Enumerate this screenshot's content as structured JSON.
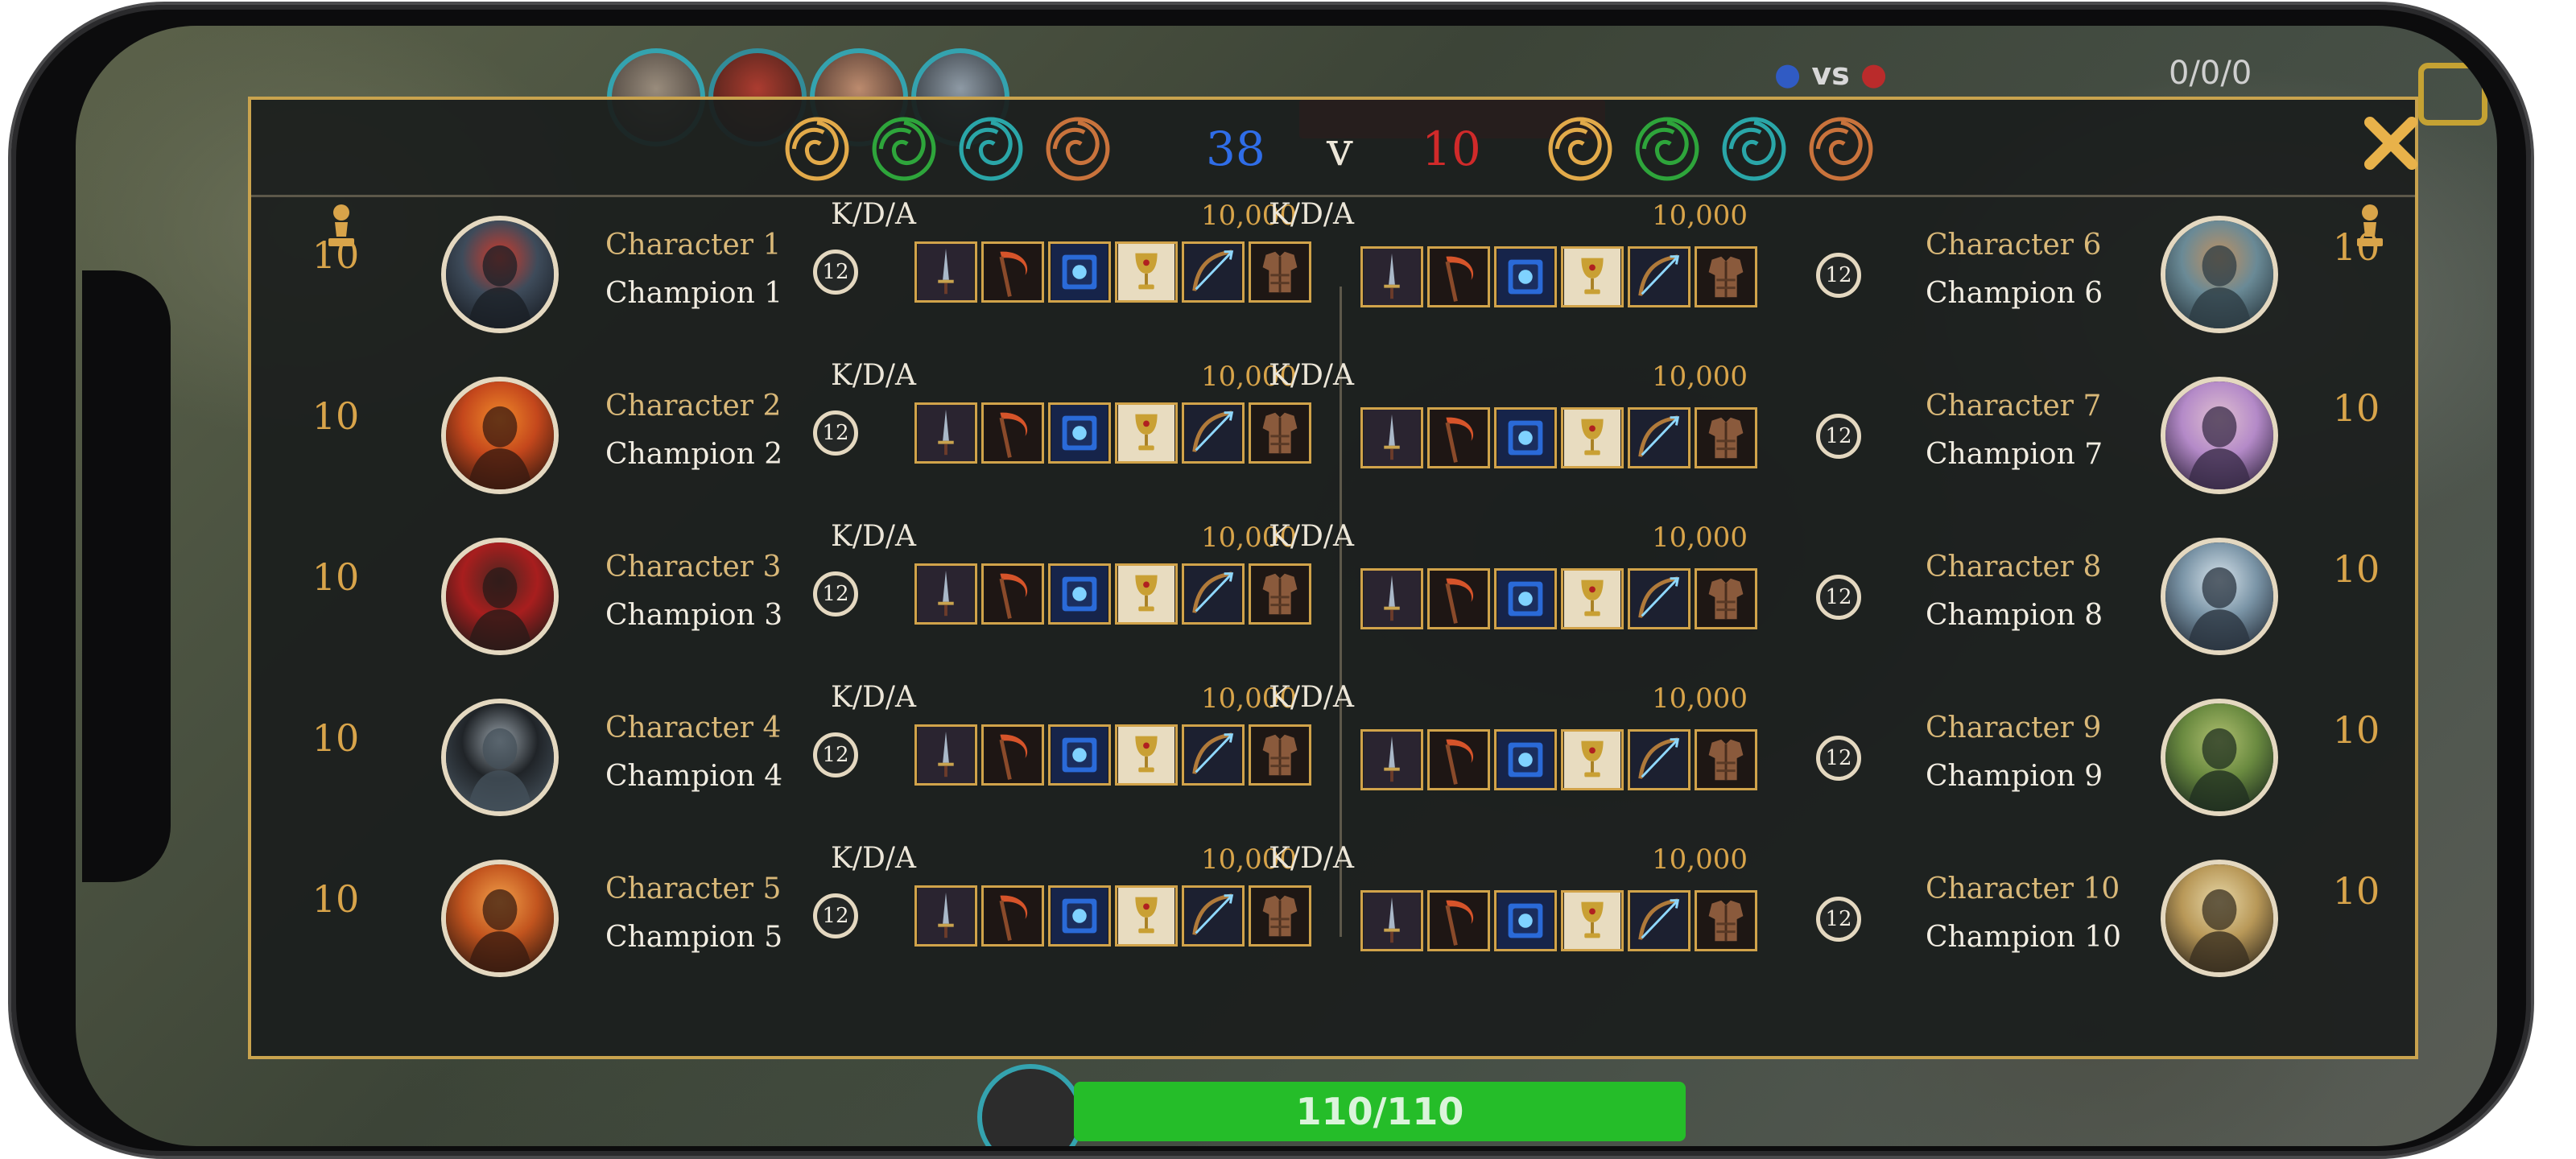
{
  "hud": {
    "vs_label": "vs",
    "kda_readout": "0/0/0",
    "hp_label": "110/110"
  },
  "scoreboard": {
    "blue_score": "38",
    "versus": "v",
    "red_score": "10",
    "colors": {
      "blue": "#2f6de8",
      "red": "#d02a2a",
      "gold": "#d8a44a",
      "accent": "#c9a34e"
    },
    "objective_icons": [
      "gold-swirl-icon",
      "green-swirl-icon",
      "teal-swirl-icon",
      "orange-swirl-icon"
    ]
  },
  "left_team": [
    {
      "level": "10",
      "character": "Character 1",
      "champion": "Champion 1",
      "rank": "12",
      "kda_label": "K/D/A",
      "gold": "10,000"
    },
    {
      "level": "10",
      "character": "Character 2",
      "champion": "Champion 2",
      "rank": "12",
      "kda_label": "K/D/A",
      "gold": "10,000"
    },
    {
      "level": "10",
      "character": "Character 3",
      "champion": "Champion 3",
      "rank": "12",
      "kda_label": "K/D/A",
      "gold": "10,000"
    },
    {
      "level": "10",
      "character": "Character 4",
      "champion": "Champion 4",
      "rank": "12",
      "kda_label": "K/D/A",
      "gold": "10,000"
    },
    {
      "level": "10",
      "character": "Character 5",
      "champion": "Champion 5",
      "rank": "12",
      "kda_label": "K/D/A",
      "gold": "10,000"
    }
  ],
  "right_team": [
    {
      "level": "10",
      "character": "Character 6",
      "champion": "Champion 6",
      "rank": "12",
      "kda_label": "K/D/A",
      "gold": "10,000"
    },
    {
      "level": "10",
      "character": "Character 7",
      "champion": "Champion 7",
      "rank": "12",
      "kda_label": "K/D/A",
      "gold": "10,000"
    },
    {
      "level": "10",
      "character": "Character 8",
      "champion": "Champion 8",
      "rank": "12",
      "kda_label": "K/D/A",
      "gold": "10,000"
    },
    {
      "level": "10",
      "character": "Character 9",
      "champion": "Champion 9",
      "rank": "12",
      "kda_label": "K/D/A",
      "gold": "10,000"
    },
    {
      "level": "10",
      "character": "Character 10",
      "champion": "Champion 10",
      "rank": "12",
      "kda_label": "K/D/A",
      "gold": "10,000"
    }
  ],
  "item_icons": [
    "sword-icon",
    "scythe-icon",
    "spellbook-icon",
    "chalice-icon",
    "bow-icon",
    "armor-icon"
  ]
}
